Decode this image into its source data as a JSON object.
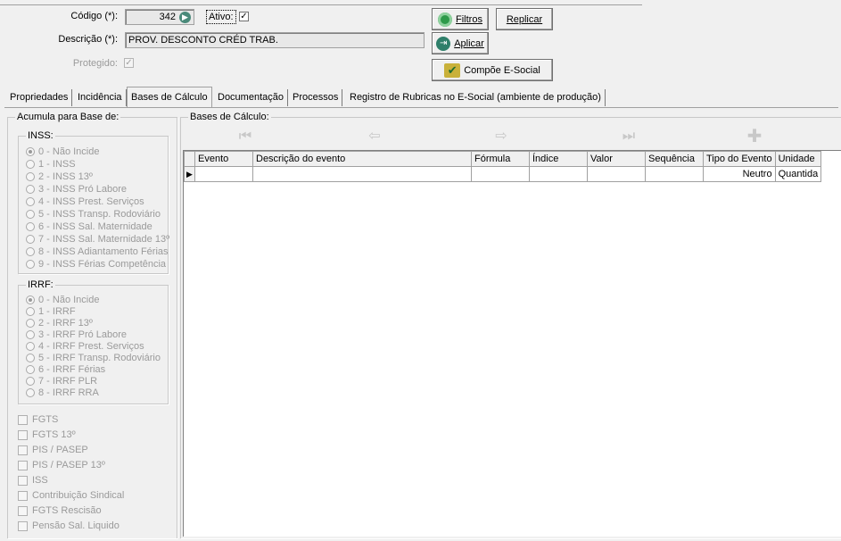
{
  "header": {
    "codigo_label": "Código (*):",
    "codigo_value": "342",
    "ativo_label": "Ativo:",
    "ativo_checked": "✓",
    "descricao_label": "Descrição (*):",
    "descricao_value": "PROV. DESCONTO CRÉD TRAB.",
    "protegido_label": "Protegido:",
    "protegido_checked": "✓"
  },
  "buttons": {
    "filtros": "Filtros",
    "replicar": "Replicar",
    "aplicar": "Aplicar",
    "compoe": "Compõe E-Social"
  },
  "tabs": [
    {
      "label": "Propriedades"
    },
    {
      "label": "Incidência"
    },
    {
      "label": "Bases de Cálculo"
    },
    {
      "label": "Documentação"
    },
    {
      "label": "Processos"
    },
    {
      "label": "Registro de Rubricas no E-Social (ambiente de produção)"
    }
  ],
  "left_panel": {
    "title": "Acumula para Base de:",
    "inss": {
      "title": "INSS:",
      "options": [
        "0 - Não Incide",
        "1 - INSS",
        "2 - INSS 13º",
        "3 - INSS Pró Labore",
        "4 - INSS Prest. Serviços",
        "5 - INSS Transp. Rodoviário",
        "6 - INSS Sal. Maternidade",
        "7 - INSS Sal. Maternidade 13º",
        "8 - INSS Adiantamento Férias",
        "9 - INSS Férias Competência"
      ]
    },
    "irrf": {
      "title": "IRRF:",
      "options": [
        "0 - Não Incide",
        "1 - IRRF",
        "2 - IRRF 13º",
        "3 - IRRF Pró Labore",
        "4 - IRRF Prest. Serviços",
        "5 - IRRF Transp. Rodoviário",
        "6 - IRRF Férias",
        "7 - IRRF PLR",
        "8 - IRRF RRA"
      ]
    },
    "checkboxes": [
      "FGTS",
      "FGTS 13º",
      "PIS / PASEP",
      "PIS / PASEP 13º",
      "ISS",
      "Contribuição Sindical",
      "FGTS Rescisão",
      "Pensão Sal. Liquido"
    ]
  },
  "right_panel": {
    "title": "Bases de Cálculo:",
    "columns": [
      "Evento",
      "Descrição do evento",
      "Fórmula",
      "Índice",
      "Valor",
      "Sequência",
      "Tipo do Evento",
      "Unidade"
    ],
    "rows": [
      {
        "evento": "",
        "descricao": "",
        "formula": "",
        "indice": "",
        "valor": "",
        "sequencia": "",
        "tipo": "Neutro",
        "unidade": "Quantida"
      }
    ]
  }
}
